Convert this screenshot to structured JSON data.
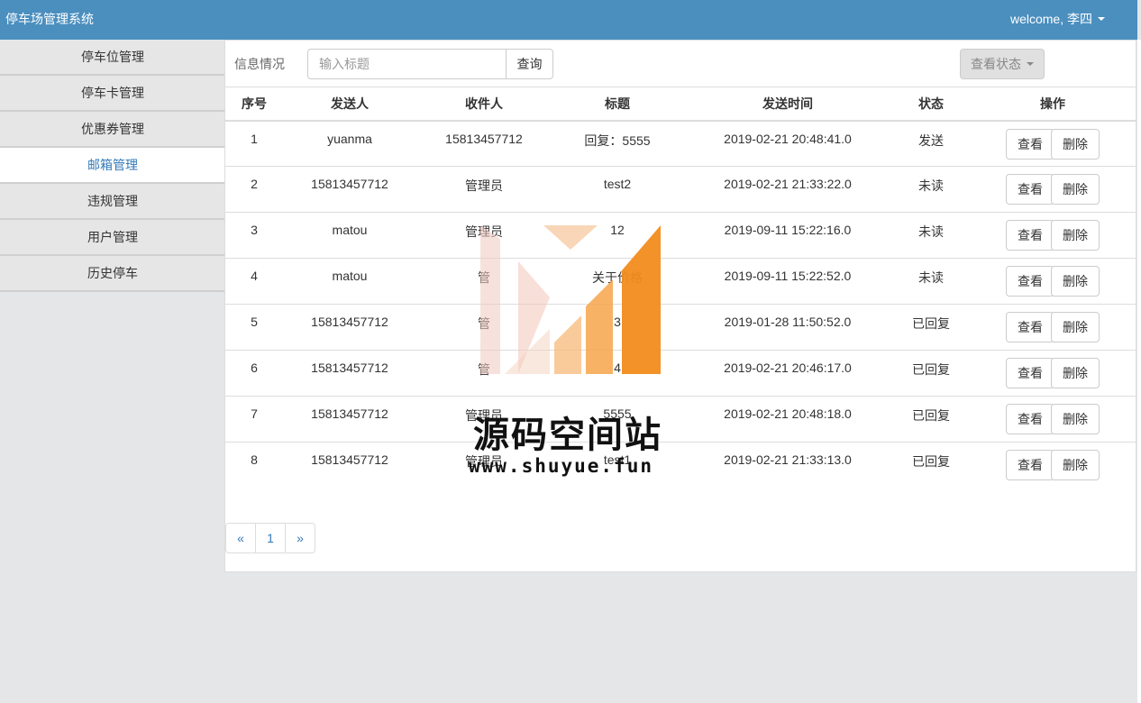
{
  "app": {
    "title": "停车场管理系统",
    "user": "welcome, 李四"
  },
  "sidebar": {
    "items": [
      {
        "label": "停车位管理"
      },
      {
        "label": "停车卡管理"
      },
      {
        "label": "优惠券管理"
      },
      {
        "label": "邮箱管理"
      },
      {
        "label": "违规管理"
      },
      {
        "label": "用户管理"
      },
      {
        "label": "历史停车"
      }
    ]
  },
  "toolbar": {
    "label": "信息情况",
    "search_placeholder": "输入标题",
    "search_button": "查询",
    "status_button": "查看状态"
  },
  "table": {
    "headers": [
      "序号",
      "发送人",
      "收件人",
      "标题",
      "发送时间",
      "状态",
      "操作"
    ],
    "view_label": "查看",
    "delete_label": "删除",
    "rows": [
      {
        "no": "1",
        "sender": "yuanma",
        "recipient": "15813457712",
        "title": "回复：5555",
        "time": "2019-02-21 20:48:41.0",
        "status": "发送"
      },
      {
        "no": "2",
        "sender": "15813457712",
        "recipient": "管理员",
        "title": "test2",
        "time": "2019-02-21 21:33:22.0",
        "status": "未读"
      },
      {
        "no": "3",
        "sender": "matou",
        "recipient": "管理员",
        "title": "12",
        "time": "2019-09-11 15:22:16.0",
        "status": "未读"
      },
      {
        "no": "4",
        "sender": "matou",
        "recipient": "管",
        "title": "关于价格",
        "time": "2019-09-11 15:22:52.0",
        "status": "未读"
      },
      {
        "no": "5",
        "sender": "15813457712",
        "recipient": "管",
        "title": "3",
        "time": "2019-01-28 11:50:52.0",
        "status": "已回复"
      },
      {
        "no": "6",
        "sender": "15813457712",
        "recipient": "管",
        "title": "4",
        "time": "2019-02-21 20:46:17.0",
        "status": "已回复"
      },
      {
        "no": "7",
        "sender": "15813457712",
        "recipient": "管理员",
        "title": "5555",
        "time": "2019-02-21 20:48:18.0",
        "status": "已回复"
      },
      {
        "no": "8",
        "sender": "15813457712",
        "recipient": "管理员",
        "title": "test1",
        "time": "2019-02-21 21:33:13.0",
        "status": "已回复"
      }
    ]
  },
  "pagination": {
    "prev": "«",
    "page": "1",
    "next": "»"
  },
  "watermark": {
    "title": "源码空间站",
    "url": "www.shuyue.fun"
  },
  "colors": {
    "navbar": "#4b8fbf",
    "link": "#337ab7",
    "watermark_orange": "#f28c1c"
  }
}
